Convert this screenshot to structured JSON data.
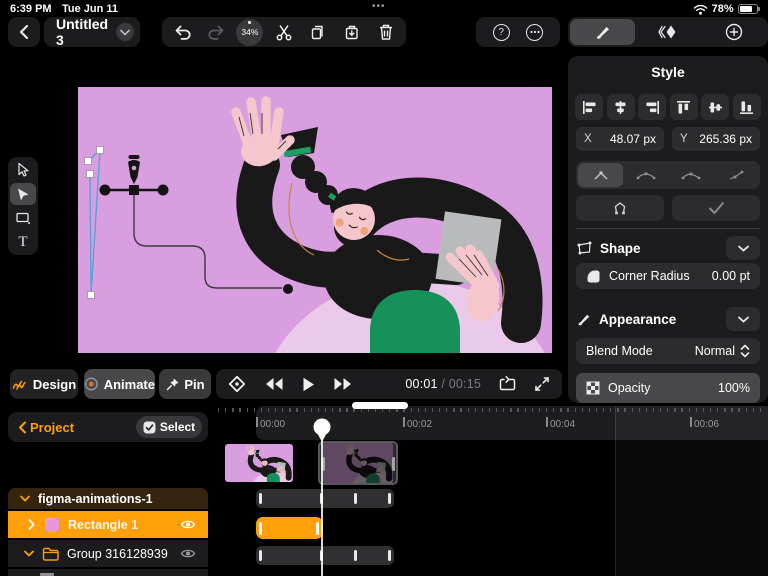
{
  "status": {
    "time": "6:39 PM",
    "date": "Tue Jun 11",
    "battery": "78%",
    "more_dots": "•••"
  },
  "toolbar": {
    "title": "Untitled 3",
    "zoom": "34%",
    "help_glyph": "?"
  },
  "style_panel": {
    "title": "Style",
    "x_label": "X",
    "x_value": "48.07 px",
    "y_label": "Y",
    "y_value": "265.36 px",
    "shape": {
      "title": "Shape",
      "corner_radius_label": "Corner Radius",
      "corner_radius_value": "0.00 pt"
    },
    "appearance": {
      "title": "Appearance",
      "blend_mode_label": "Blend Mode",
      "blend_mode_value": "Normal",
      "opacity_label": "Opacity",
      "opacity_value": "100%"
    }
  },
  "playback": {
    "design": "Design",
    "animate": "Animate",
    "pin": "Pin",
    "current_time": "00:01",
    "separator": " / ",
    "total_time": "00:15"
  },
  "timeline": {
    "project": "Project",
    "select": "Select",
    "ruler_labels": [
      "00:00",
      "00:02",
      "00:04",
      "00:06"
    ],
    "layers": [
      {
        "name": "figma-animations-1"
      },
      {
        "name": "Rectangle 1"
      },
      {
        "name": "Group 316128939"
      }
    ]
  },
  "tools": {
    "text_tool_glyph": "T"
  },
  "colors": {
    "accent": "#FF9F0A",
    "selection_blue": "#5C9FD3",
    "canvas_pink": "#D99EE0",
    "skirt_green": "#16915A",
    "panel": "#1C1C1E"
  }
}
